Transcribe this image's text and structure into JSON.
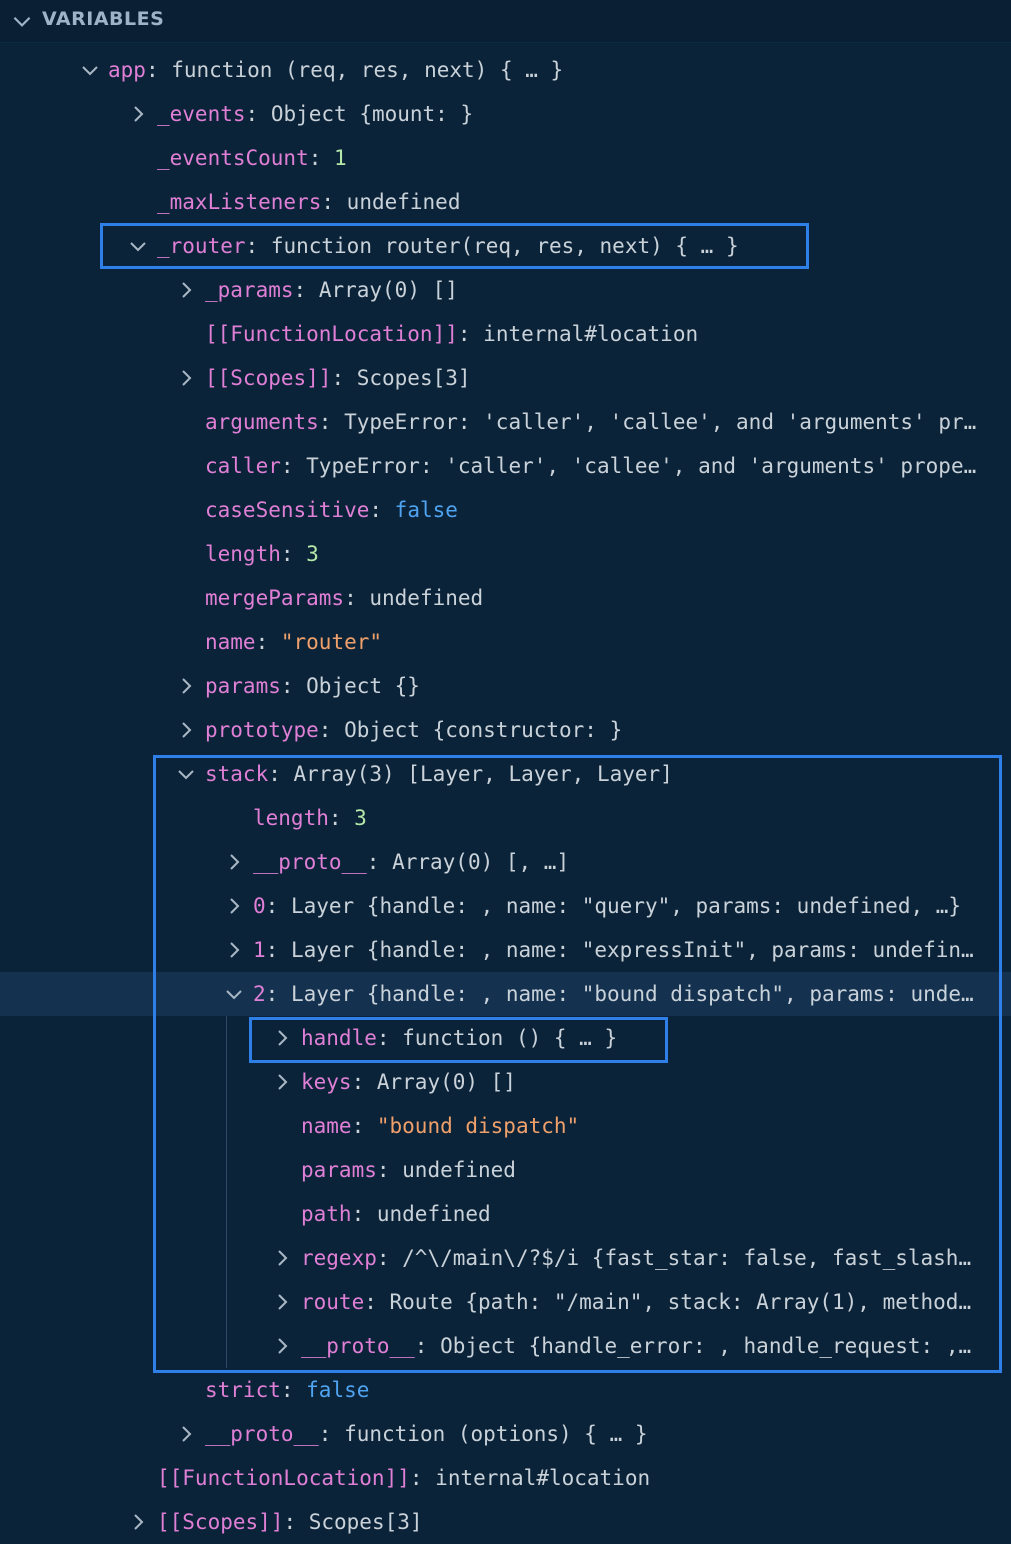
{
  "panel": {
    "title": "VARIABLES",
    "expanded": true
  },
  "rows": [
    {
      "depth": 0,
      "twisty": "expanded",
      "key": "app",
      "value": "function (req, res, next) { … }",
      "type": "plain"
    },
    {
      "depth": 1,
      "twisty": "collapsed",
      "key": "_events",
      "value": "Object {mount: }",
      "type": "plain"
    },
    {
      "depth": 1,
      "twisty": "none",
      "key": "_eventsCount",
      "value": "1",
      "type": "num"
    },
    {
      "depth": 1,
      "twisty": "none",
      "key": "_maxListeners",
      "value": "undefined",
      "type": "plain"
    },
    {
      "depth": 1,
      "twisty": "expanded",
      "key": "_router",
      "value": "function router(req, res, next) { … }",
      "type": "plain"
    },
    {
      "depth": 2,
      "twisty": "collapsed",
      "key": "_params",
      "value": "Array(0) []",
      "type": "plain"
    },
    {
      "depth": 2,
      "twisty": "none",
      "key": "[[FunctionLocation]]",
      "value": "internal#location",
      "type": "plain"
    },
    {
      "depth": 2,
      "twisty": "collapsed",
      "key": "[[Scopes]]",
      "value": "Scopes[3]",
      "type": "plain"
    },
    {
      "depth": 2,
      "twisty": "none",
      "key": "arguments",
      "value": "TypeError: 'caller', 'callee', and 'arguments' pr…",
      "type": "plain"
    },
    {
      "depth": 2,
      "twisty": "none",
      "key": "caller",
      "value": "TypeError: 'caller', 'callee', and 'arguments' prope…",
      "type": "plain"
    },
    {
      "depth": 2,
      "twisty": "none",
      "key": "caseSensitive",
      "value": "false",
      "type": "bool"
    },
    {
      "depth": 2,
      "twisty": "none",
      "key": "length",
      "value": "3",
      "type": "num"
    },
    {
      "depth": 2,
      "twisty": "none",
      "key": "mergeParams",
      "value": "undefined",
      "type": "plain"
    },
    {
      "depth": 2,
      "twisty": "none",
      "key": "name",
      "value": "\"router\"",
      "type": "str"
    },
    {
      "depth": 2,
      "twisty": "collapsed",
      "key": "params",
      "value": "Object {}",
      "type": "plain"
    },
    {
      "depth": 2,
      "twisty": "collapsed",
      "key": "prototype",
      "value": "Object {constructor: }",
      "type": "plain"
    },
    {
      "depth": 2,
      "twisty": "expanded",
      "key": "stack",
      "value": "Array(3) [Layer, Layer, Layer]",
      "type": "plain"
    },
    {
      "depth": 3,
      "twisty": "none",
      "key": "length",
      "value": "3",
      "type": "num"
    },
    {
      "depth": 3,
      "twisty": "collapsed",
      "key": "__proto__",
      "value": "Array(0) [, …]",
      "type": "plain"
    },
    {
      "depth": 3,
      "twisty": "collapsed",
      "key": "0",
      "value": "Layer {handle: , name: \"query\", params: undefined, …}",
      "type": "plain"
    },
    {
      "depth": 3,
      "twisty": "collapsed",
      "key": "1",
      "value": "Layer {handle: , name: \"expressInit\", params: undefin…",
      "type": "plain"
    },
    {
      "depth": 3,
      "twisty": "expanded",
      "key": "2",
      "value": "Layer {handle: , name: \"bound dispatch\", params: unde…",
      "type": "plain",
      "focused": true
    },
    {
      "depth": 4,
      "twisty": "collapsed",
      "key": "handle",
      "value": "function () { … }",
      "type": "plain"
    },
    {
      "depth": 4,
      "twisty": "collapsed",
      "key": "keys",
      "value": "Array(0) []",
      "type": "plain"
    },
    {
      "depth": 4,
      "twisty": "none",
      "key": "name",
      "value": "\"bound dispatch\"",
      "type": "str"
    },
    {
      "depth": 4,
      "twisty": "none",
      "key": "params",
      "value": "undefined",
      "type": "plain"
    },
    {
      "depth": 4,
      "twisty": "none",
      "key": "path",
      "value": "undefined",
      "type": "plain"
    },
    {
      "depth": 4,
      "twisty": "collapsed",
      "key": "regexp",
      "value": "/^\\/main\\/?$/i {fast_star: false, fast_slash…",
      "type": "plain"
    },
    {
      "depth": 4,
      "twisty": "collapsed",
      "key": "route",
      "value": "Route {path: \"/main\", stack: Array(1), method…",
      "type": "plain"
    },
    {
      "depth": 4,
      "twisty": "collapsed",
      "key": "__proto__",
      "value": "Object {handle_error: , handle_request: ,…",
      "type": "plain"
    },
    {
      "depth": 2,
      "twisty": "none",
      "key": "strict",
      "value": "false",
      "type": "bool"
    },
    {
      "depth": 2,
      "twisty": "collapsed",
      "key": "__proto__",
      "value": "function (options) { … }",
      "type": "plain"
    },
    {
      "depth": 1,
      "twisty": "none",
      "key": "[[FunctionLocation]]",
      "value": "internal#location",
      "type": "plain"
    },
    {
      "depth": 1,
      "twisty": "collapsed",
      "key": "[[Scopes]]",
      "value": "Scopes[3]",
      "type": "plain"
    }
  ],
  "colors": {
    "background": "#0b2338",
    "key": "#e07fd6",
    "number": "#b5e8a9",
    "string": "#f0a06a",
    "boolean": "#4fa3f0",
    "highlight_box": "#2e80e8",
    "focused_row": "#143250"
  },
  "icons": {
    "expanded": "chevron-down-icon",
    "collapsed": "chevron-right-icon"
  }
}
